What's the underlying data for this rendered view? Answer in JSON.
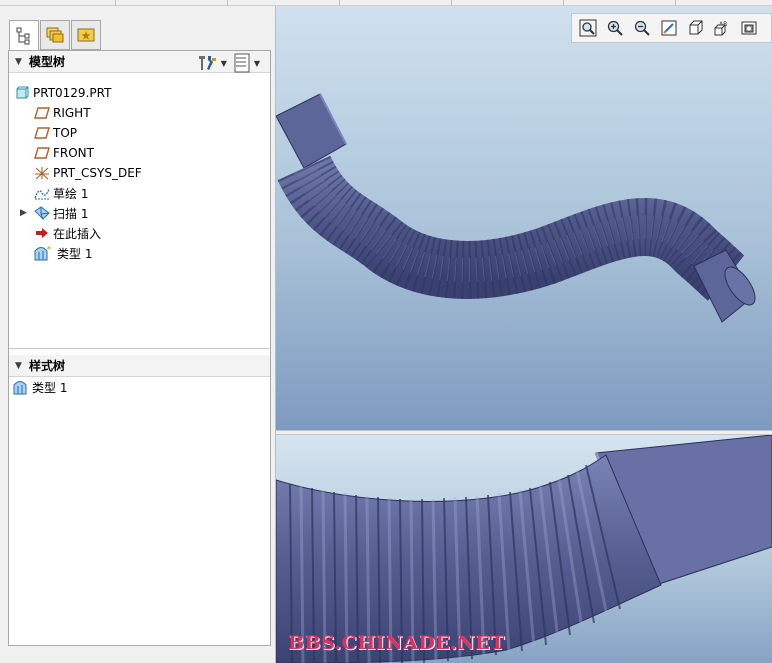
{
  "model_tree": {
    "title": "模型树",
    "items": [
      {
        "label": "PRT0129.PRT",
        "icon": "part-icon"
      },
      {
        "label": "RIGHT",
        "icon": "datum-plane-icon"
      },
      {
        "label": "TOP",
        "icon": "datum-plane-icon"
      },
      {
        "label": "FRONT",
        "icon": "datum-plane-icon"
      },
      {
        "label": "PRT_CSYS_DEF",
        "icon": "csys-icon"
      },
      {
        "label": "草绘 1",
        "icon": "sketch-icon"
      },
      {
        "label": "扫描 1",
        "icon": "sweep-icon"
      },
      {
        "label": "在此插入",
        "icon": "insert-here-icon"
      },
      {
        "label": "类型 1",
        "icon": "style-icon"
      }
    ]
  },
  "style_tree": {
    "title": "样式树",
    "items": [
      {
        "label": "类型 1",
        "icon": "style-icon"
      }
    ]
  },
  "view_toolbar": [
    "refit-icon",
    "zoom-in-icon",
    "zoom-out-icon",
    "repaint-icon",
    "display-style-icon",
    "saved-views-icon",
    "named-view-icon"
  ],
  "watermark": "BBS.CHINADE.NET",
  "colors": {
    "model": "#5a6294",
    "background_top": "#cfe1ee",
    "background_bottom": "#7e9ac0",
    "watermark": "#e13060"
  }
}
